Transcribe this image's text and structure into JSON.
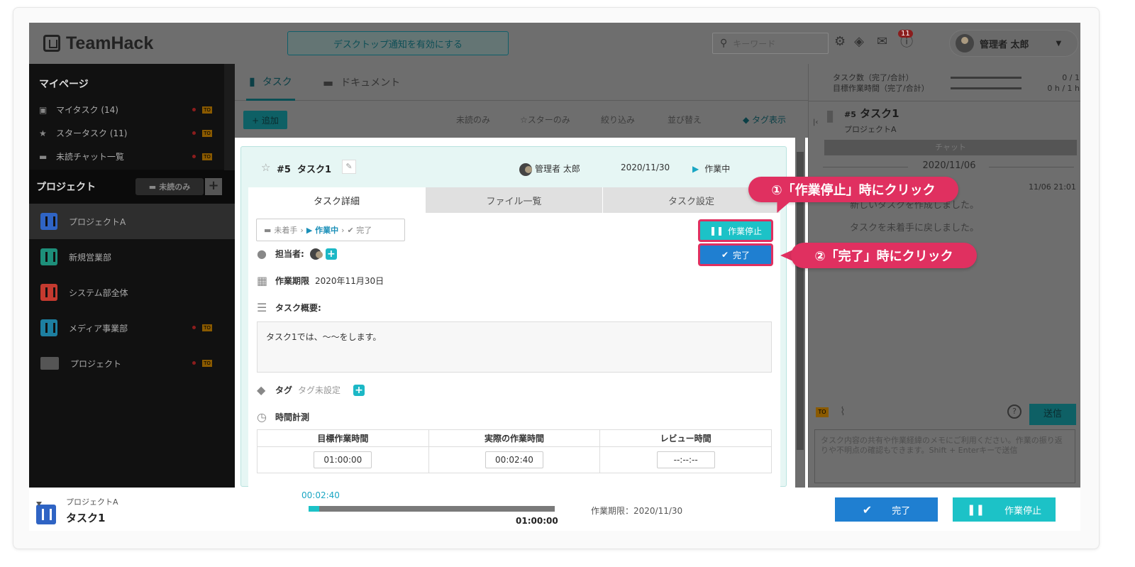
{
  "header": {
    "app_name": "TeamHack",
    "notify_label": "デスクトップ通知を有効にする",
    "search_placeholder": "キーワード",
    "notification_count": "11",
    "user_name": "管理者 太郎"
  },
  "sidebar": {
    "mypage_title": "マイページ",
    "my_items": [
      {
        "label": "マイタスク (14)",
        "icon": "document-icon"
      },
      {
        "label": "スタータスク (11)",
        "icon": "star-icon"
      },
      {
        "label": "未読チャット一覧",
        "icon": "chat-icon"
      }
    ],
    "todo_badge": "TO",
    "project_title": "プロジェクト",
    "unread_only_label": "未読のみ",
    "add_symbol": "+",
    "projects": [
      {
        "label": "プロジェクトA",
        "color": "#2f64c4",
        "active": true
      },
      {
        "label": "新規営業部",
        "color": "#1d8f7a",
        "active": false
      },
      {
        "label": "システム部全体",
        "color": "#c43a2f",
        "active": false
      },
      {
        "label": "メディア事業部",
        "color": "#1d7fa0",
        "active": false
      },
      {
        "label": "プロジェクト",
        "color": "#555555",
        "active": false
      }
    ]
  },
  "main": {
    "tab_task": "タスク",
    "tab_document": "ドキュメント",
    "add_button": "+ 追加",
    "filter_unread": "未読のみ",
    "filter_star": "☆スターのみ",
    "filter_narrow": "絞り込み",
    "sort": "並び替え",
    "tag_display": "タグ表示"
  },
  "modal": {
    "task_number": "#5",
    "task_title": "タスク1",
    "owner": "管理者 太郎",
    "date": "2020/11/30",
    "status": "作業中",
    "tabs": [
      "タスク詳細",
      "ファイル一覧",
      "タスク設定"
    ],
    "flow_not_started": "未着手",
    "flow_in_progress": "作業中",
    "flow_done": "✔ 完了",
    "stop_button": "作業停止",
    "done_button": "完了",
    "assignee_label": "担当者:",
    "due_label": "作業期限",
    "due_value": "2020年11月30日",
    "summary_label": "タスク概要:",
    "summary_text": "タスク1では、〜〜をします。",
    "tag_label": "タグ",
    "tag_value": "タグ未設定",
    "time_label": "時間計測",
    "time_headers": [
      "目標作業時間",
      "実際の作業時間",
      "レビュー時間"
    ],
    "time_values": [
      "01:00:00",
      "00:02:40",
      "--:--:--"
    ]
  },
  "right_panel": {
    "stat_tasks_label": "タスク数（完了/合計）",
    "stat_tasks_value": "0 / 1",
    "stat_hours_label": "目標作業時間（完了/合計）",
    "stat_hours_value": "0 h / 1 h",
    "task_number": "#5",
    "task_title": "タスク1",
    "project": "プロジェクトA",
    "chat_button": "チャット",
    "date": "2020/11/06",
    "time": "11/06 21:01",
    "message1": "新しいタスクを作成しました。",
    "message2": "タスクを未着手に戻しました。",
    "todo_badge": "TO",
    "send_button": "送信",
    "input_placeholder": "タスク内容の共有や作業経緯のメモにご利用ください。作業の振り返りや不明点の確認もできます。Shift + Enterキーで送信"
  },
  "bottom": {
    "project": "プロジェクトA",
    "task": "タスク1",
    "elapsed": "00:02:40",
    "target": "01:00:00",
    "progress_fraction": 0.044,
    "due": "作業期限：2020/11/30",
    "done_button": "完了",
    "stop_button": "作業停止"
  },
  "callouts": {
    "one": "①「作業停止」時にクリック",
    "two": "②「完了」時にクリック"
  },
  "colors": {
    "accent_teal": "#1cc2c7",
    "accent_blue": "#1f7fd1",
    "callout_red": "#e03060"
  }
}
